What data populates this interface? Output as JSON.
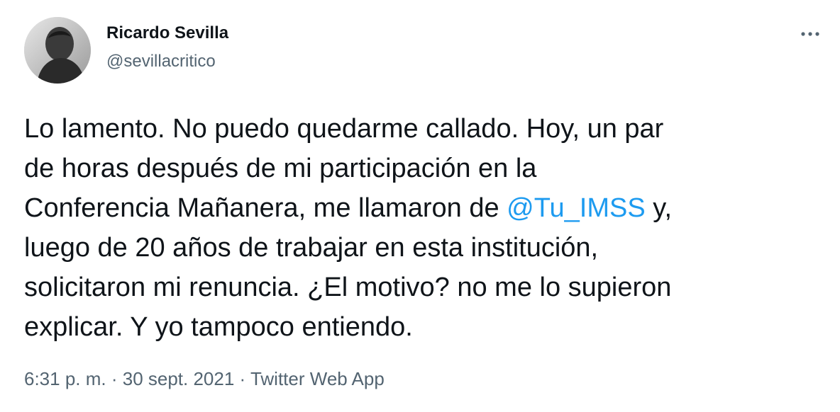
{
  "author": {
    "name": "Ricardo Sevilla",
    "handle": "@sevillacritico"
  },
  "more_menu": {
    "icon": "more-horizontal-icon"
  },
  "tweet": {
    "lines": [
      {
        "text": "Lo lamento. No puedo quedarme callado. Hoy, un par"
      },
      {
        "text": "de horas después de mi participación en la"
      },
      {
        "before": "Conferencia Mañanera, me llamaron de ",
        "mention": "@Tu_IMSS",
        "after": " y,"
      },
      {
        "text": "luego de 20 años de trabajar en esta institución,"
      },
      {
        "text": "solicitaron mi renuncia. ¿El motivo? no me lo supieron"
      },
      {
        "text": "explicar. Y yo tampoco entiendo."
      }
    ]
  },
  "meta": {
    "time": "6:31 p. m.",
    "separator": " · ",
    "date": "30 sept. 2021",
    "source": "Twitter Web App"
  },
  "colors": {
    "text": "#0f1419",
    "secondary": "#536471",
    "link": "#1d9bf0"
  }
}
